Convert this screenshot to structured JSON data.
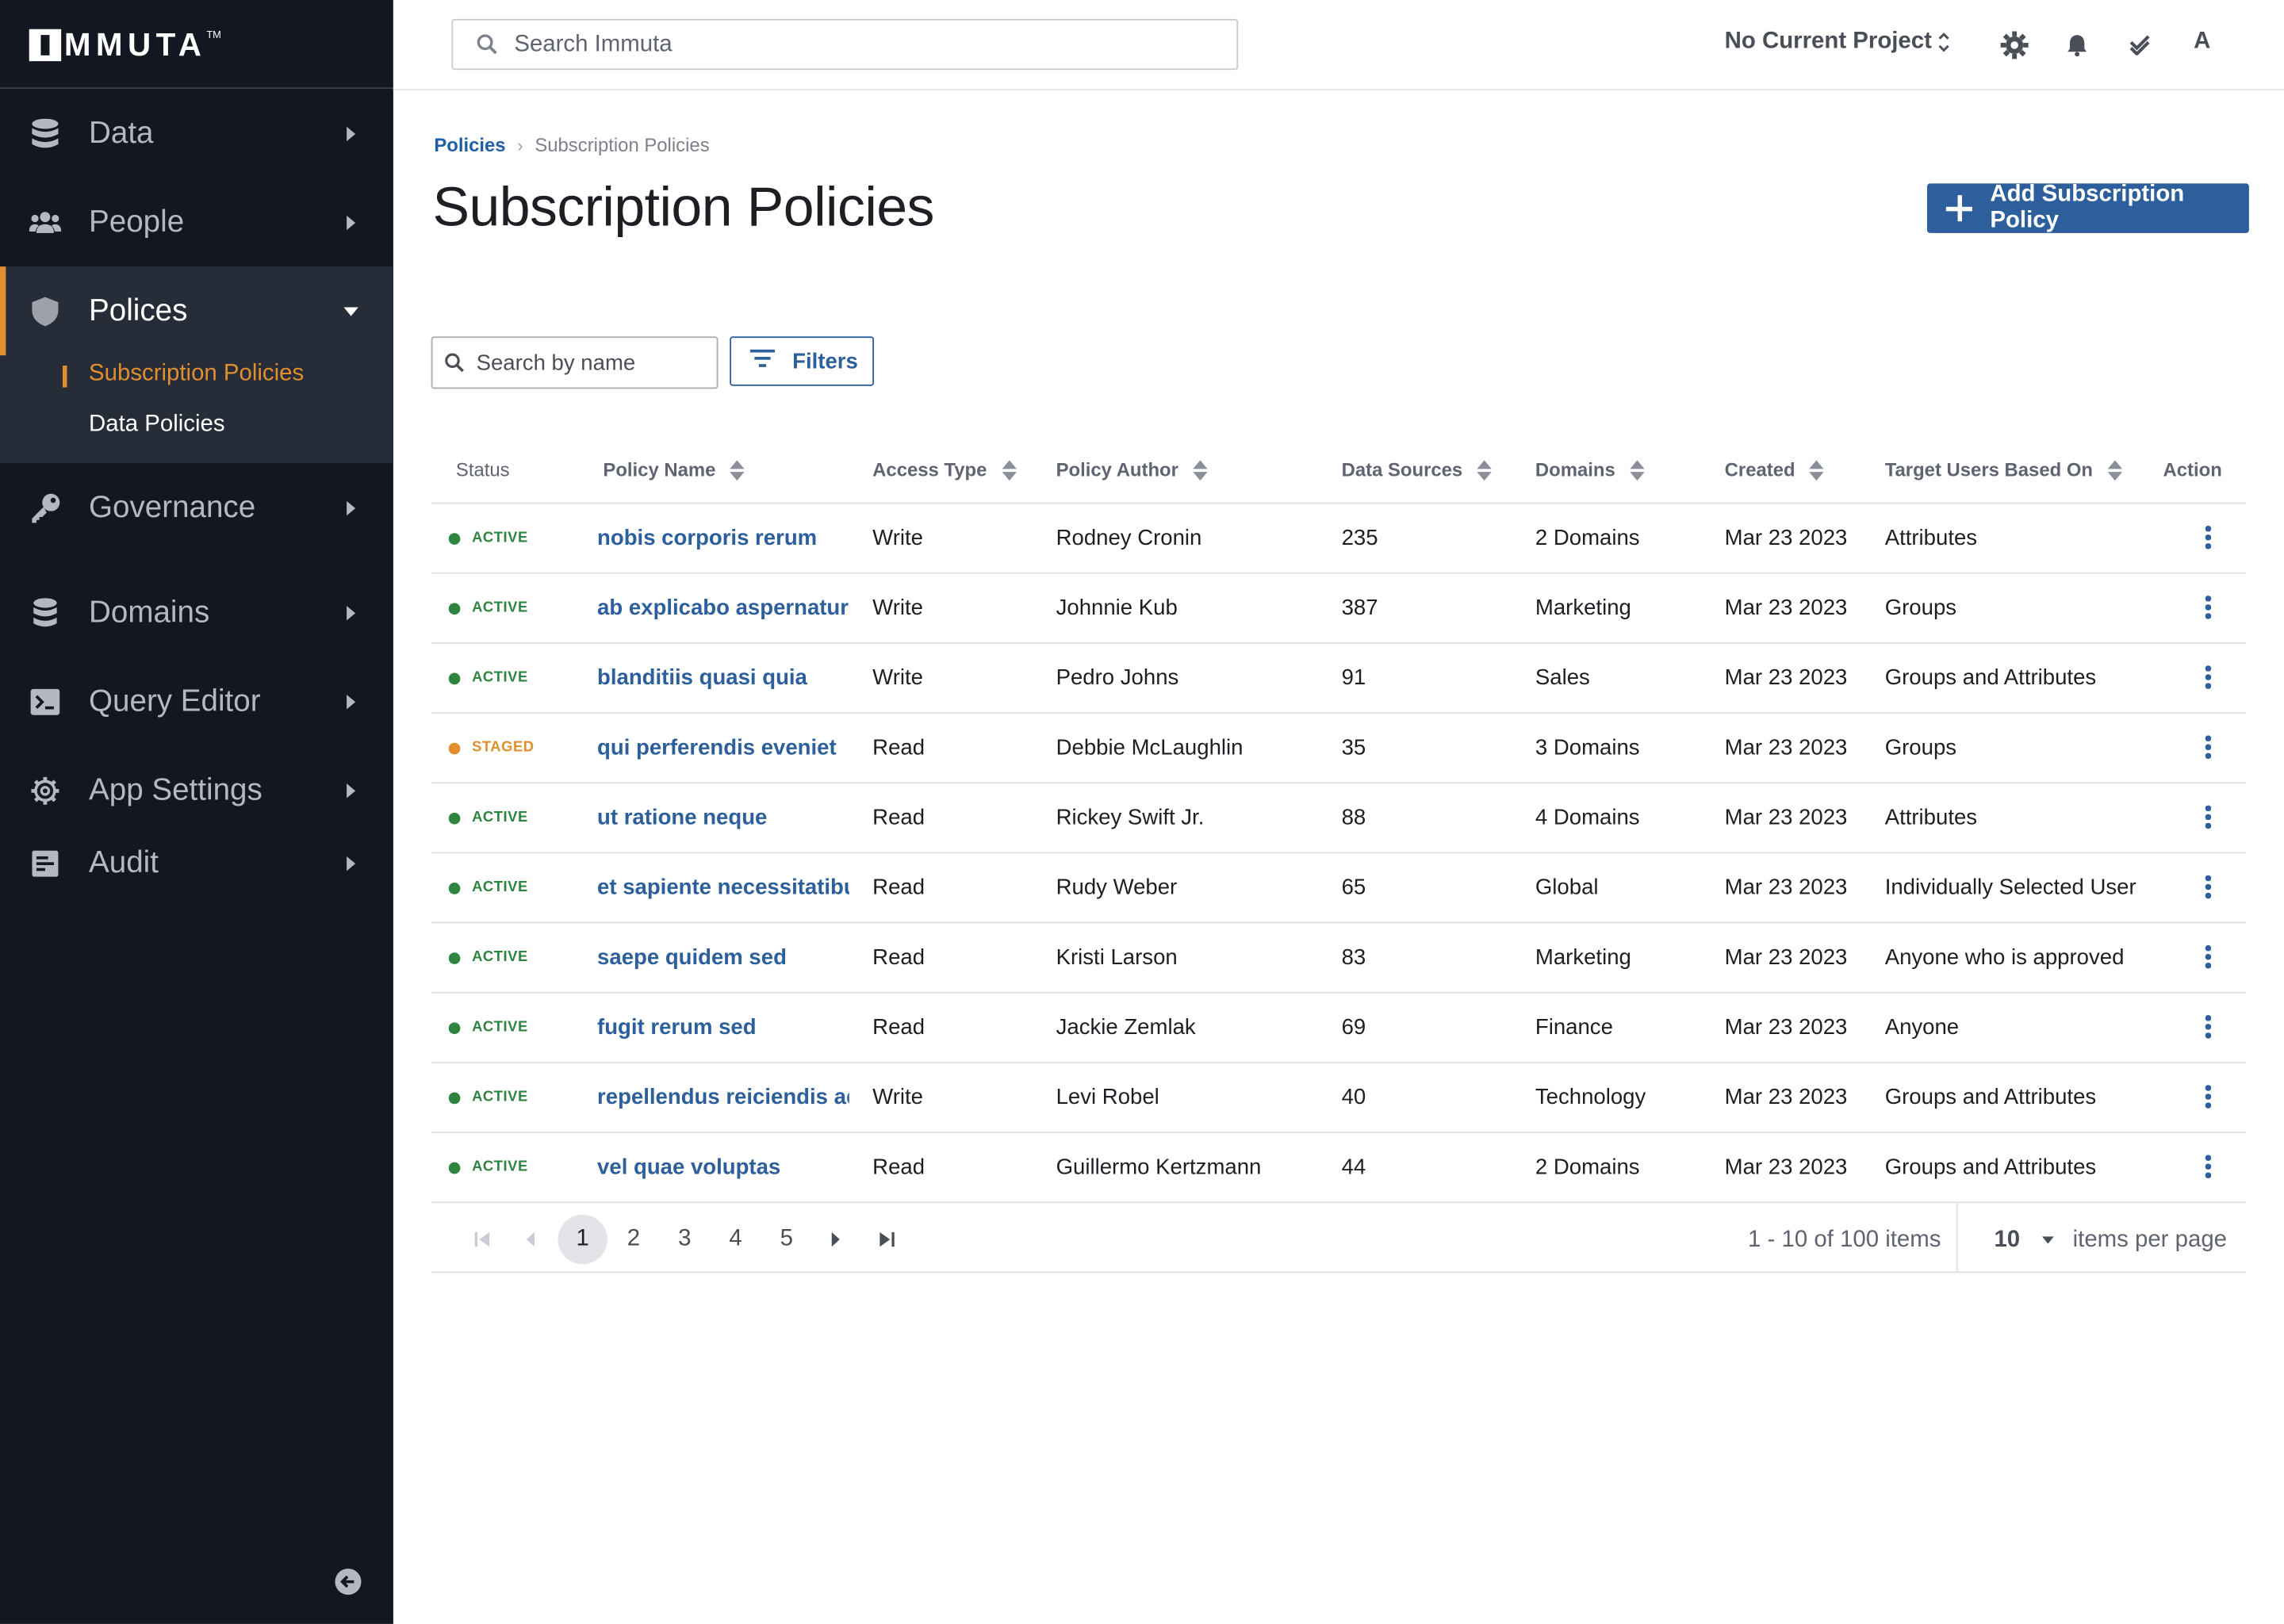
{
  "app": {
    "logo_text": "MMUTA",
    "logo_tm": "TM"
  },
  "sidebar": {
    "items": [
      {
        "label": "Data",
        "icon": "database-icon"
      },
      {
        "label": "People",
        "icon": "people-icon"
      },
      {
        "label": "Polices",
        "icon": "shield-icon",
        "expanded": true
      },
      {
        "label": "Governance",
        "icon": "key-icon"
      },
      {
        "label": "Domains",
        "icon": "database-icon"
      },
      {
        "label": "Query Editor",
        "icon": "terminal-icon"
      },
      {
        "label": "App Settings",
        "icon": "gear-icon"
      },
      {
        "label": "Audit",
        "icon": "audit-icon"
      }
    ],
    "policies_sub": [
      {
        "label": "Subscription Policies",
        "active": true
      },
      {
        "label": "Data Policies",
        "active": false
      }
    ],
    "collapse_icon": "arrow-left-circle-icon",
    "accent_color": "#e08e2e",
    "background": "#131722"
  },
  "topbar": {
    "search_placeholder": "Search Immuta",
    "project_label": "No Current Project",
    "avatar_initial": "A",
    "icons": [
      "gear-icon",
      "bell-icon",
      "double-check-icon"
    ]
  },
  "breadcrumb": {
    "parent": "Policies",
    "current": "Subscription Policies"
  },
  "page": {
    "title": "Subscription Policies",
    "add_button": "Add Subscription Policy",
    "name_search_placeholder": "Search by name",
    "filters_button": "Filters",
    "primary_color": "#2c5f9b"
  },
  "table": {
    "columns": {
      "status": "Status",
      "name": "Policy Name",
      "access": "Access Type",
      "author": "Policy Author",
      "sources": "Data Sources",
      "domains": "Domains",
      "created": "Created",
      "target": "Target Users Based On",
      "action": "Action"
    },
    "rows": [
      {
        "status": "ACTIVE",
        "name": "nobis corporis rerum",
        "access": "Write",
        "author": "Rodney Cronin",
        "sources": "235",
        "domains": "2 Domains",
        "created": "Mar 23 2023",
        "target": "Attributes"
      },
      {
        "status": "ACTIVE",
        "name": "ab explicabo aspernatur",
        "access": "Write",
        "author": "Johnnie Kub",
        "sources": "387",
        "domains": "Marketing",
        "created": "Mar 23 2023",
        "target": "Groups"
      },
      {
        "status": "ACTIVE",
        "name": "blanditiis quasi quia",
        "access": "Write",
        "author": "Pedro Johns",
        "sources": "91",
        "domains": "Sales",
        "created": "Mar 23 2023",
        "target": "Groups and Attributes"
      },
      {
        "status": "STAGED",
        "name": "qui perferendis eveniet",
        "access": "Read",
        "author": "Debbie McLaughlin",
        "sources": "35",
        "domains": "3 Domains",
        "created": "Mar 23 2023",
        "target": "Groups"
      },
      {
        "status": "ACTIVE",
        "name": "ut ratione neque",
        "access": "Read",
        "author": "Rickey Swift Jr.",
        "sources": "88",
        "domains": "4 Domains",
        "created": "Mar 23 2023",
        "target": "Attributes"
      },
      {
        "status": "ACTIVE",
        "name": "et sapiente necessitatibu",
        "access": "Read",
        "author": "Rudy Weber",
        "sources": "65",
        "domains": "Global",
        "created": "Mar 23 2023",
        "target": "Individually Selected User"
      },
      {
        "status": "ACTIVE",
        "name": "saepe quidem sed",
        "access": "Read",
        "author": "Kristi Larson",
        "sources": "83",
        "domains": "Marketing",
        "created": "Mar 23 2023",
        "target": "Anyone who is approved"
      },
      {
        "status": "ACTIVE",
        "name": "fugit rerum sed",
        "access": "Read",
        "author": "Jackie Zemlak",
        "sources": "69",
        "domains": "Finance",
        "created": "Mar 23 2023",
        "target": "Anyone"
      },
      {
        "status": "ACTIVE",
        "name": "repellendus reiciendis ad",
        "access": "Write",
        "author": "Levi Robel",
        "sources": "40",
        "domains": "Technology",
        "created": "Mar 23 2023",
        "target": "Groups and Attributes"
      },
      {
        "status": "ACTIVE",
        "name": "vel quae voluptas",
        "access": "Read",
        "author": "Guillermo Kertzmann",
        "sources": "44",
        "domains": "2 Domains",
        "created": "Mar 23 2023",
        "target": "Groups and Attributes"
      }
    ],
    "status_colors": {
      "ACTIVE": "#2e8540",
      "STAGED": "#e08e2e"
    }
  },
  "pagination": {
    "pages": [
      "1",
      "2",
      "3",
      "4",
      "5"
    ],
    "current_page": "1",
    "info": "1 - 10 of 100 items",
    "page_size": "10",
    "per_page_label": "items per page"
  }
}
